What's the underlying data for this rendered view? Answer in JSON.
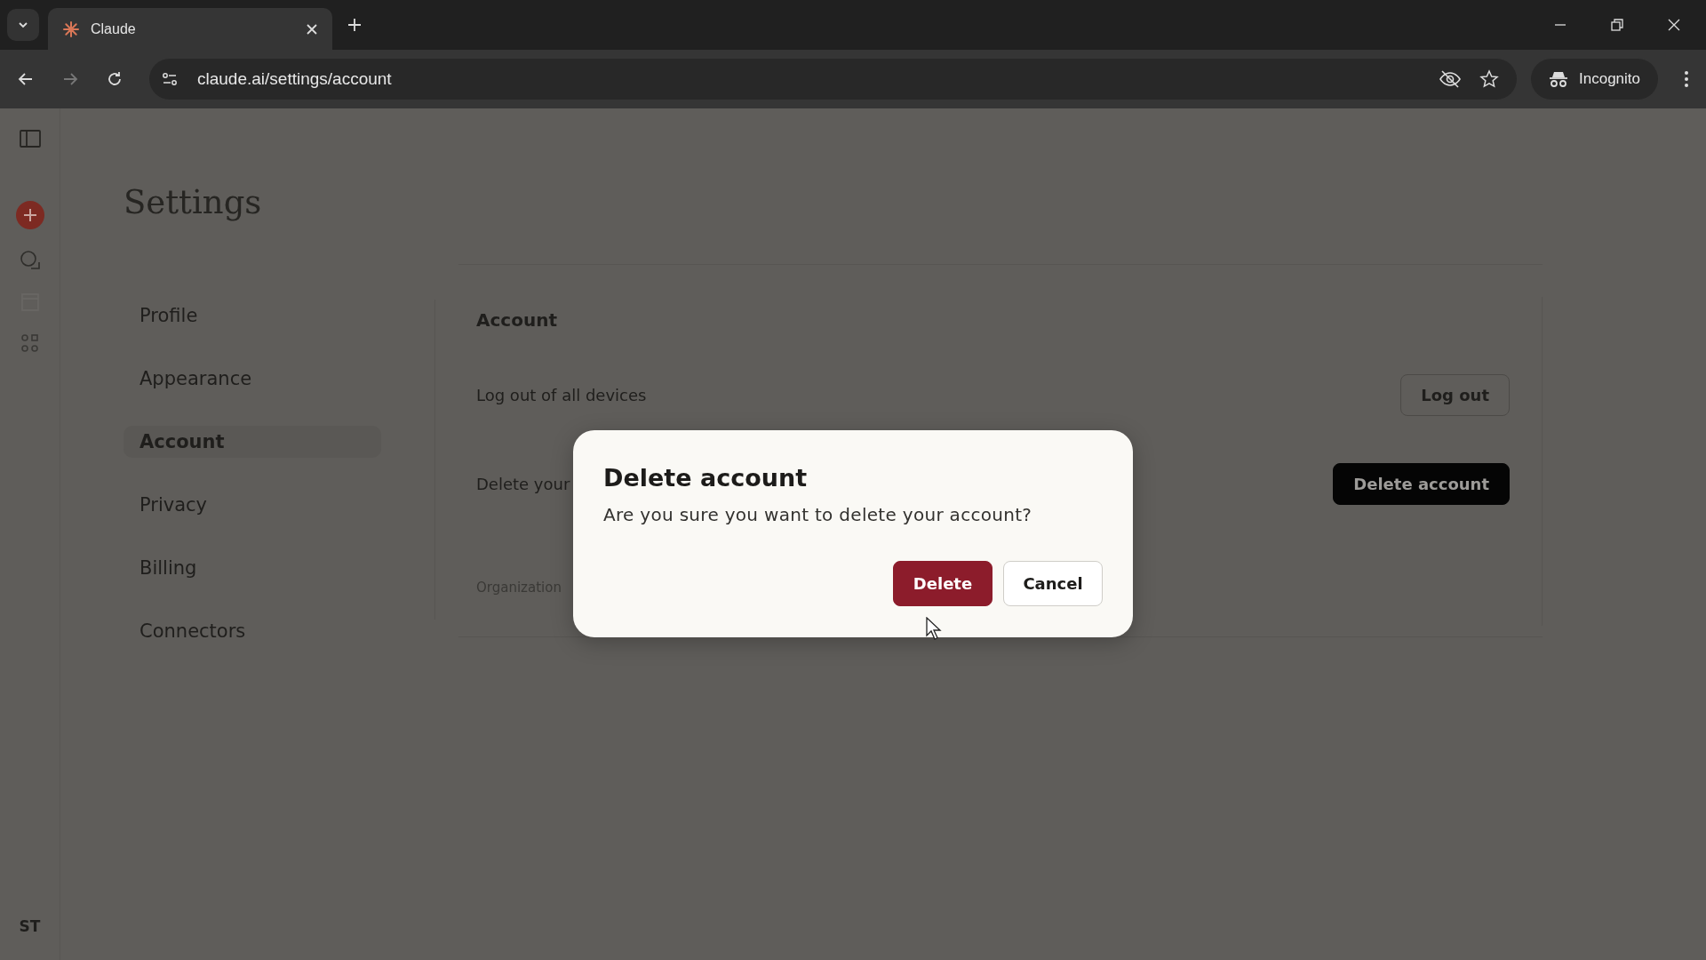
{
  "browser": {
    "tab_title": "Claude",
    "url": "claude.ai/settings/account",
    "profile_label": "Incognito"
  },
  "sidebar": {
    "avatar_initials": "ST"
  },
  "settings": {
    "title": "Settings",
    "nav": [
      {
        "label": "Profile",
        "selected": false
      },
      {
        "label": "Appearance",
        "selected": false
      },
      {
        "label": "Account",
        "selected": true
      },
      {
        "label": "Privacy",
        "selected": false
      },
      {
        "label": "Billing",
        "selected": false
      },
      {
        "label": "Connectors",
        "selected": false
      }
    ]
  },
  "account": {
    "heading": "Account",
    "rows": [
      {
        "label": "Log out of all devices",
        "button": "Log out",
        "kind": "outline"
      },
      {
        "label": "Delete your",
        "button": "Delete account",
        "kind": "dark"
      }
    ],
    "footer_label": "Organization"
  },
  "dialog": {
    "title": "Delete account",
    "message": "Are you sure you want to delete your account?",
    "confirm": "Delete",
    "cancel": "Cancel"
  }
}
